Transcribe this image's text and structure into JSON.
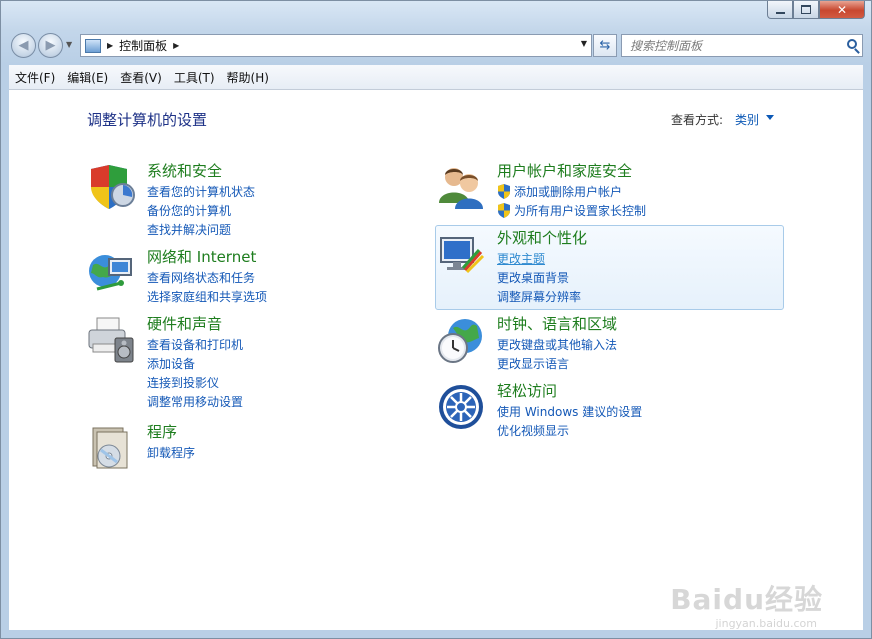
{
  "address": {
    "crumb": "控制面板"
  },
  "search": {
    "placeholder": "搜索控制面板"
  },
  "menu": [
    "文件(F)",
    "编辑(E)",
    "查看(V)",
    "工具(T)",
    "帮助(H)"
  ],
  "page_title": "调整计算机的设置",
  "view_by": {
    "label": "查看方式:",
    "value": "类别"
  },
  "categories": [
    {
      "title": "系统和安全",
      "icon": "system-security-icon",
      "links": [
        "查看您的计算机状态",
        "备份您的计算机",
        "查找并解决问题"
      ]
    },
    {
      "title": "网络和 Internet",
      "icon": "network-internet-icon",
      "links": [
        "查看网络状态和任务",
        "选择家庭组和共享选项"
      ]
    },
    {
      "title": "硬件和声音",
      "icon": "hardware-sound-icon",
      "links": [
        "查看设备和打印机",
        "添加设备",
        "连接到投影仪",
        "调整常用移动设置"
      ]
    },
    {
      "title": "程序",
      "icon": "programs-icon",
      "links": [
        "卸载程序"
      ]
    },
    {
      "title": "用户帐户和家庭安全",
      "icon": "user-accounts-icon",
      "links": [
        "添加或删除用户帐户",
        "为所有用户设置家长控制"
      ]
    },
    {
      "title": "外观和个性化",
      "icon": "appearance-icon",
      "links": [
        "更改主题",
        "更改桌面背景",
        "调整屏幕分辨率"
      ]
    },
    {
      "title": "时钟、语言和区域",
      "icon": "clock-language-icon",
      "links": [
        "更改键盘或其他输入法",
        "更改显示语言"
      ]
    },
    {
      "title": "轻松访问",
      "icon": "ease-of-access-icon",
      "links": [
        "使用 Windows 建议的设置",
        "优化视频显示"
      ]
    }
  ],
  "watermark": {
    "main": "Baidu经验",
    "sub": "jingyan.baidu.com"
  }
}
